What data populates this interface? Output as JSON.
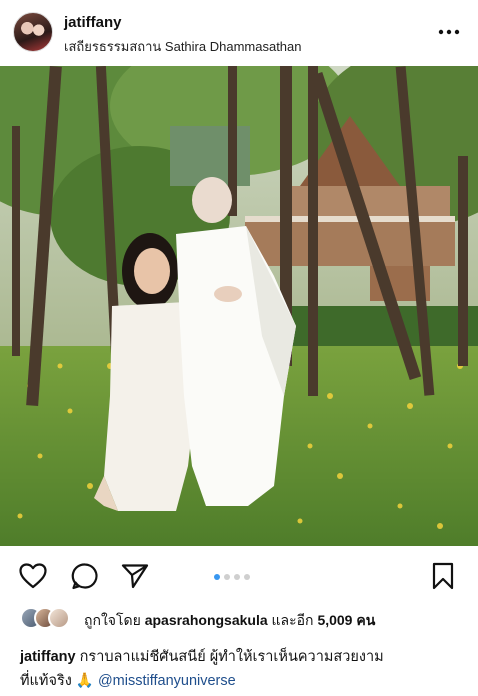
{
  "post": {
    "username": "jatiffany",
    "location": "เสถียรธรรมสถาน Sathira Dhammasathan",
    "likes_prefix": "ถูกใจโดย",
    "likes_user": "apasrahongsakula",
    "likes_middle": "และอีก",
    "likes_count": "5,009",
    "likes_suffix": "คน",
    "caption_user": "jatiffany",
    "caption_text_line1": "กราบลาแม่ชีศันสนีย์ ผู้ทำให้เราเห็นความสวยงาม",
    "caption_text_line2": "ที่แท้จริง",
    "caption_emoji": "🙏",
    "caption_mention": "@misstiffanyuniverse",
    "carousel": {
      "total": 4,
      "active": 1
    }
  },
  "icons": {
    "more": "more-horizontal-icon",
    "like": "heart-icon",
    "comment": "comment-icon",
    "share": "send-icon",
    "save": "bookmark-icon"
  },
  "colors": {
    "carousel_active": "#3897f0",
    "mention": "#1f4e8c"
  }
}
